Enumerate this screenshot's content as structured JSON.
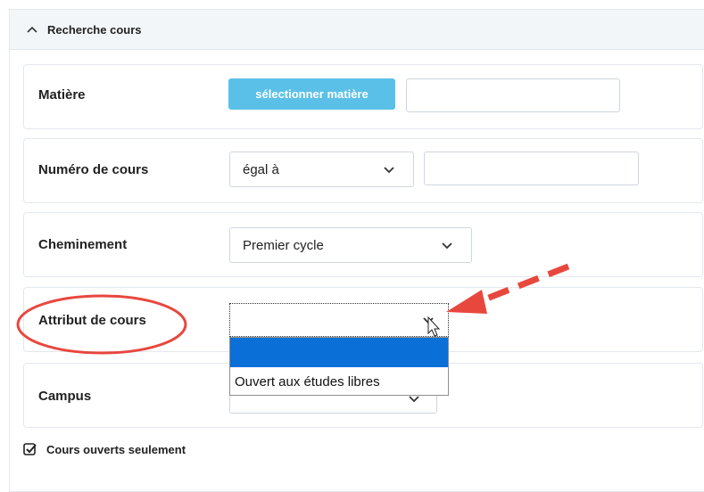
{
  "panel": {
    "title": "Recherche cours",
    "expanded": true
  },
  "fields": {
    "subject": {
      "label": "Matière",
      "button_label": "sélectionner matière",
      "value": ""
    },
    "course_number": {
      "label": "Numéro de cours",
      "operator": "égal à",
      "value": ""
    },
    "path": {
      "label": "Cheminement",
      "value": "Premier cycle"
    },
    "course_attribute": {
      "label": "Attribut de cours",
      "value": "",
      "options": [
        "",
        "Ouvert aux études libres"
      ],
      "highlighted_option_index": 0
    },
    "campus": {
      "label": "Campus",
      "value": ""
    }
  },
  "open_courses": {
    "label": "Cours ouverts seulement",
    "checked": true
  },
  "annotations": {
    "arrow_color": "#e8473e",
    "circle_color": "#e8473e"
  }
}
